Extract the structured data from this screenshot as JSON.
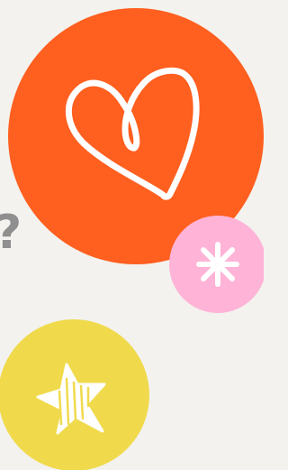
{
  "theme": {
    "background": "#f3f2ee",
    "accent_orange": "#ff5f1f",
    "accent_pink": "#ffb3d6",
    "accent_yellow": "#f0da4c",
    "icon_stroke": "#ffffff",
    "qmark_color": "#8f8f8f"
  },
  "decor": {
    "question_mark": "?",
    "heart_icon": "heart-icon",
    "asterisk_icon": "asterisk-icon",
    "star_icon": "star-icon"
  }
}
